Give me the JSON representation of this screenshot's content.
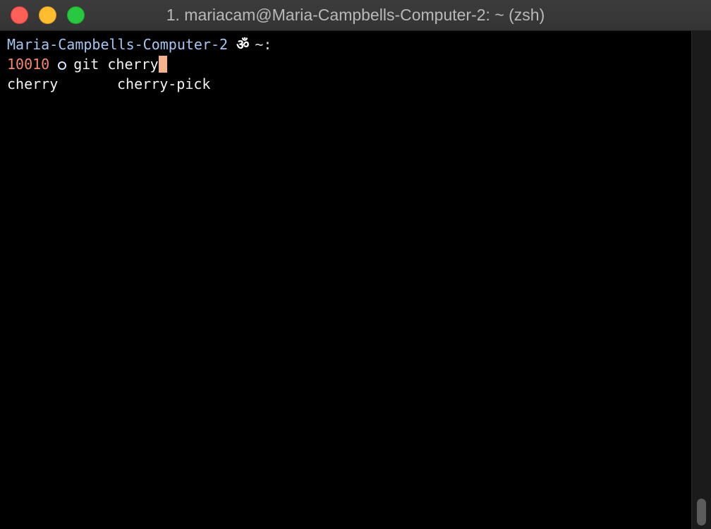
{
  "window": {
    "title": "1. mariacam@Maria-Campbells-Computer-2: ~ (zsh)"
  },
  "prompt": {
    "hostname": "Maria-Campbells-Computer-2",
    "symbol": "ॐ",
    "cwd": "~:",
    "exit_code": "10010",
    "git_status_icon": "ring-icon",
    "command": "git cherry"
  },
  "completions": [
    "cherry",
    "cherry-pick"
  ],
  "colors": {
    "background": "#000000",
    "hostname": "#a6c6f2",
    "exit_code": "#f78772",
    "cursor": "#f7b38b",
    "text": "#f2f2f2"
  }
}
